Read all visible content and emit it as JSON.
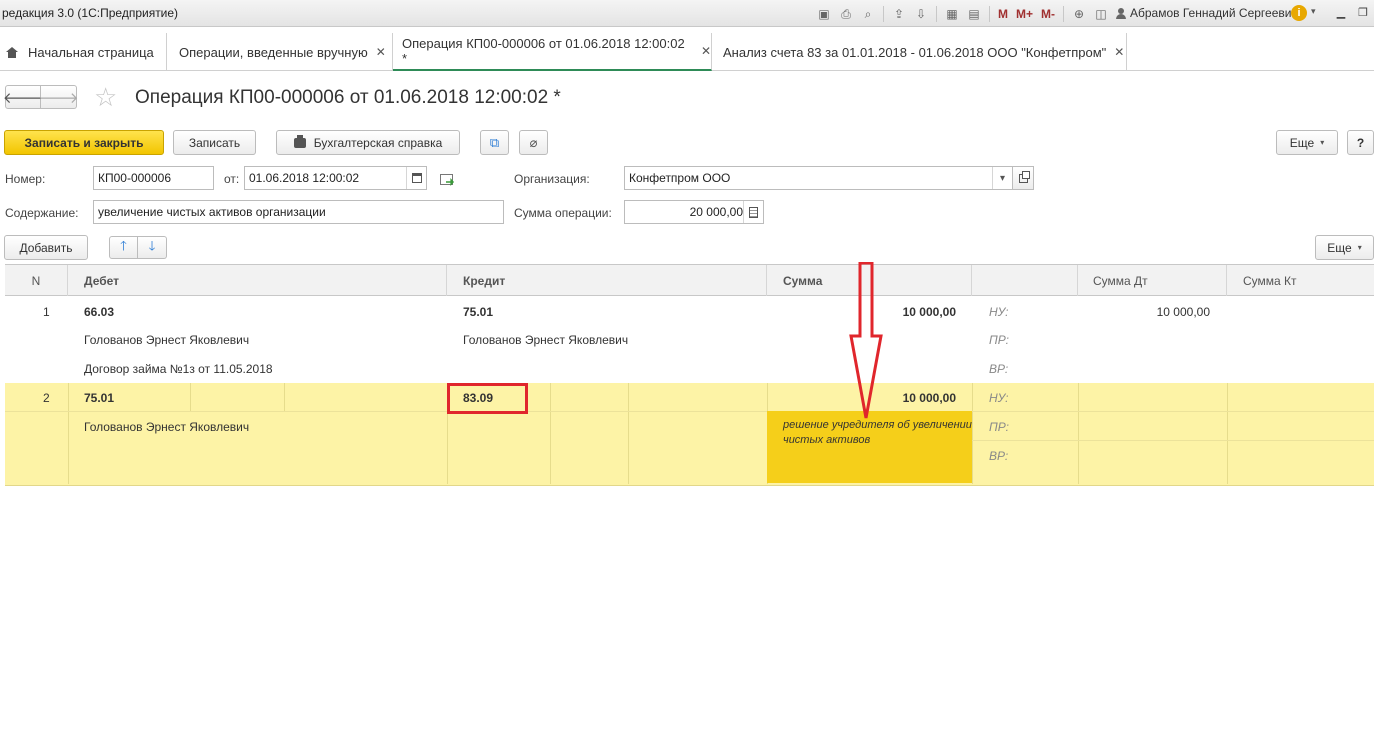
{
  "titlebar": {
    "app_title": "редакция 3.0  (1С:Предприятие)",
    "user_name": "Абрамов Геннадий Сергеевич",
    "m_buttons": [
      "M",
      "M+",
      "M-"
    ],
    "icons": [
      "save-icon",
      "print-icon",
      "preview-icon",
      "upload-icon",
      "download-icon",
      "calculator-icon",
      "calendar-icon",
      "zoom-icon",
      "panel-icon",
      "info-icon",
      "minimize-icon",
      "restore-icon"
    ]
  },
  "tabs": [
    {
      "label": "Начальная страница"
    },
    {
      "label": "Операции, введенные вручную",
      "close": "✕"
    },
    {
      "label": "Операция КП00-000006 от 01.06.2018 12:00:02 *",
      "close": "✕"
    },
    {
      "label": "Анализ счета 83 за 01.01.2018 - 01.06.2018 ООО \"Конфетпром\"",
      "close": "✕"
    }
  ],
  "header": {
    "title": "Операция КП00-000006 от 01.06.2018 12:00:02 *"
  },
  "toolbar": {
    "save_close": "Записать и закрыть",
    "save": "Записать",
    "report": "Бухгалтерская справка",
    "more": "Еще",
    "help": "?"
  },
  "form": {
    "number_label": "Номер:",
    "number_value": "КП00-000006",
    "date_label": "от:",
    "date_value": "01.06.2018 12:00:02",
    "org_label": "Организация:",
    "org_value": "Конфетпром ООО",
    "content_label": "Содержание:",
    "content_value": "увеличение чистых активов организации",
    "sum_label": "Сумма операции:",
    "sum_value": "20 000,00"
  },
  "table_toolbar": {
    "add": "Добавить",
    "more": "Еще"
  },
  "table": {
    "headers": {
      "n": "N",
      "debit": "Дебет",
      "credit": "Кредит",
      "sum": "Сумма",
      "sum_dt": "Сумма Дт",
      "sum_kt": "Сумма Кт"
    },
    "rows": [
      {
        "n": "1",
        "debit_account": "66.03",
        "debit_sub1": "Голованов Эрнест Яковлевич",
        "debit_sub2": "Договор займа №1з от 11.05.2018",
        "credit_account": "75.01",
        "credit_sub1": "Голованов Эрнест Яковлевич",
        "sum": "10 000,00",
        "nu": "НУ:",
        "pr": "ПР:",
        "vr": "ВР:",
        "sum_dt": "10 000,00"
      },
      {
        "n": "2",
        "debit_account": "75.01",
        "debit_sub1": "Голованов Эрнест Яковлевич",
        "credit_account": "83.09",
        "sum": "10 000,00",
        "note": "решение учредителя об увеличении чистых активов",
        "nu": "НУ:",
        "pr": "ПР:",
        "vr": "ВР:"
      }
    ]
  },
  "colors": {
    "primary_button": "#f2c500",
    "selected_row": "#fdf3a6",
    "note_bg": "#f5cf1a",
    "annotation_red": "#e0262c",
    "active_tab_underline": "#2e8b57"
  }
}
